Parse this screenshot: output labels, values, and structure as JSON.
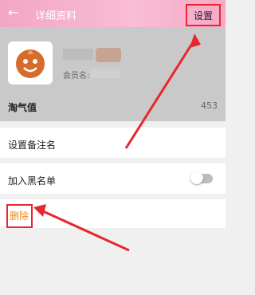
{
  "header": {
    "title": "详细资料",
    "back_label": "←",
    "settings_label": "设置"
  },
  "profile": {
    "member_label": "会员名:",
    "taoqi_label": "淘气值",
    "taoqi_value": "453"
  },
  "rows": {
    "remark": "设置备注名",
    "blacklist": "加入黑名单",
    "delete": "删除"
  },
  "colors": {
    "accent_red": "#e8262e",
    "delete_text": "#ef8a1a"
  }
}
